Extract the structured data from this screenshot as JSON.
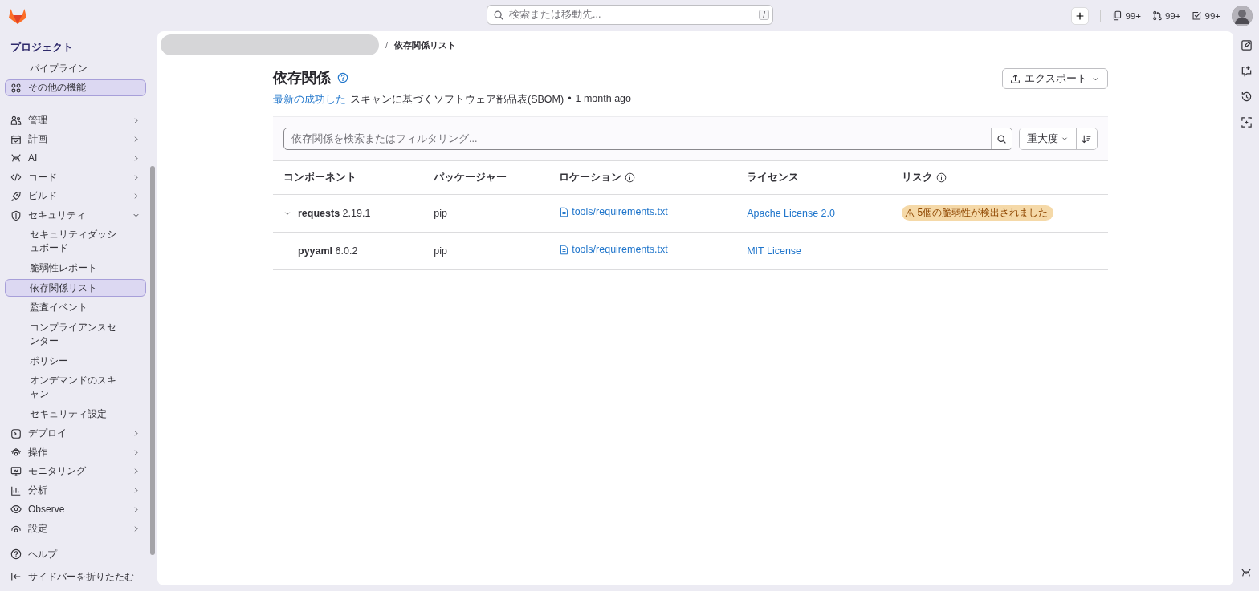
{
  "top_bar": {
    "search": {
      "placeholder": "検索または移動先...",
      "shortcut": "/"
    },
    "counters": [
      {
        "count": "99+"
      },
      {
        "count": "99+"
      },
      {
        "count": "99+"
      }
    ]
  },
  "sidebar": {
    "title": "プロジェクト",
    "items": [
      {
        "label": "パイプライン",
        "selected": false
      },
      {
        "label": "その他の機能",
        "selected": true
      }
    ],
    "nav": [
      {
        "label": "管理",
        "expanded": false,
        "selected": false
      },
      {
        "label": "計画",
        "expanded": false,
        "selected": false
      },
      {
        "label": "AI",
        "expanded": false,
        "selected": false
      },
      {
        "label": "コード",
        "expanded": false,
        "selected": false
      },
      {
        "label": "ビルド",
        "expanded": false,
        "selected": false
      },
      {
        "label": "セキュリティ",
        "expanded": true,
        "selected": false,
        "children": [
          {
            "label": "セキュリティダッシュボード",
            "selected": false
          },
          {
            "label": "脆弱性レポート",
            "selected": false
          },
          {
            "label": "依存関係リスト",
            "selected": true
          },
          {
            "label": "監査イベント",
            "selected": false
          },
          {
            "label": "コンプライアンスセンター",
            "selected": false
          },
          {
            "label": "ポリシー",
            "selected": false
          },
          {
            "label": "オンデマンドのスキャン",
            "selected": false
          },
          {
            "label": "セキュリティ設定",
            "selected": false
          }
        ]
      },
      {
        "label": "デプロイ",
        "expanded": false,
        "selected": false
      },
      {
        "label": "操作",
        "expanded": false,
        "selected": false
      },
      {
        "label": "モニタリング",
        "expanded": false,
        "selected": false
      },
      {
        "label": "分析",
        "expanded": false,
        "selected": false
      },
      {
        "label": "Observe",
        "expanded": false,
        "selected": false
      },
      {
        "label": "設定",
        "expanded": false,
        "selected": false
      }
    ],
    "footer": [
      {
        "label": "ヘルプ"
      },
      {
        "label": "サイドバーを折りたたむ"
      }
    ]
  },
  "breadcrumb": {
    "separator": "/",
    "current": "依存関係リスト"
  },
  "header": {
    "title": "依存関係",
    "link": "最新の成功した",
    "subtitle": "スキャンに基づくソフトウェア部品表(SBOM)",
    "bullet": "•",
    "time": "1 month ago",
    "export_button": "エクスポート"
  },
  "filter": {
    "placeholder": "依存関係を検索またはフィルタリング...",
    "sort": "重大度"
  },
  "table": {
    "columns": [
      {
        "label": "コンポーネント",
        "info": false
      },
      {
        "label": "パッケージャー",
        "info": false
      },
      {
        "label": "ロケーション",
        "info": true
      },
      {
        "label": "ライセンス",
        "info": false
      },
      {
        "label": "リスク",
        "info": true
      }
    ],
    "rows": [
      {
        "name": "requests",
        "version": "2.19.1",
        "expanded": true,
        "packager": "pip",
        "location": "tools/requirements.txt",
        "license": "Apache License 2.0",
        "risk": "5個の脆弱性が検出されました"
      },
      {
        "name": "pyyaml",
        "version": "6.0.2",
        "expanded": false,
        "packager": "pip",
        "location": "tools/requirements.txt",
        "license": "MIT License"
      }
    ]
  }
}
